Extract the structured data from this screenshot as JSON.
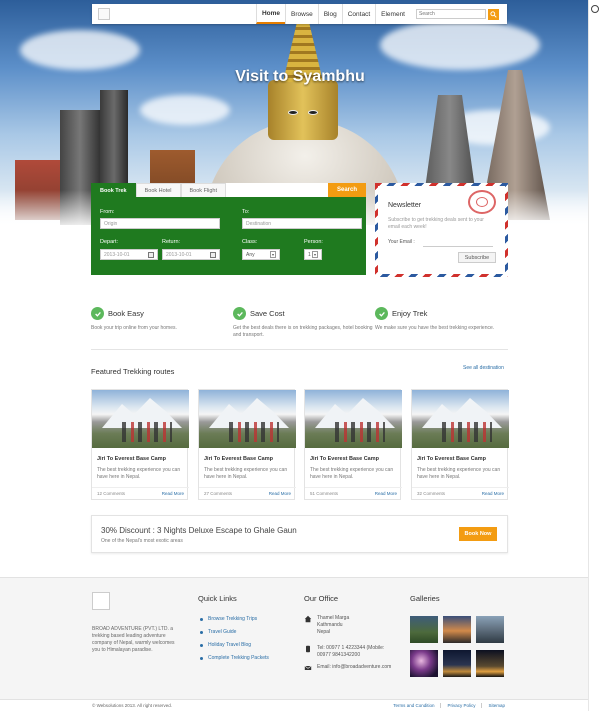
{
  "nav": {
    "items": [
      "Home",
      "Browse",
      "Blog",
      "Contact",
      "Element"
    ],
    "search_placeholder": "Search"
  },
  "hero": {
    "title": "Visit to Syambhu"
  },
  "booking": {
    "tabs": [
      "Book Trek",
      "Book Hotel",
      "Book Flight"
    ],
    "search_label": "Search",
    "from_label": "From:",
    "from_placeholder": "Origin",
    "to_label": "To:",
    "to_placeholder": "Destination",
    "depart_label": "Depart:",
    "depart_value": "2013-10-01",
    "return_label": "Return:",
    "return_value": "2013-10-01",
    "class_label": "Class:",
    "class_value": "Any",
    "person_label": "Person:",
    "person_value": "1"
  },
  "newsletter": {
    "title": "Newsletter",
    "description": "Subscribe to get trekking deals sent to your email each week!",
    "email_label": "Your Email :",
    "button": "Subscribe"
  },
  "features": [
    {
      "title": "Book Easy",
      "desc": "Book your trip online from your homes."
    },
    {
      "title": "Save Cost",
      "desc": "Get the best deals there is on trekking packages, hotel booking and transport."
    },
    {
      "title": "Enjoy Trek",
      "desc": "We make sure you have the best trekking experience."
    }
  ],
  "featured": {
    "title": "Featured Trekking routes",
    "see_all": "See all destination",
    "cards": [
      {
        "title": "Jiri To Everest Base Camp",
        "desc": "The best trekking experience you can have here in Nepal.",
        "comments": "12 Comments",
        "read_more": "Read More"
      },
      {
        "title": "Jiri To Everest Base Camp",
        "desc": "The best trekking experience you can have here in Nepal.",
        "comments": "27 Comments",
        "read_more": "Read More"
      },
      {
        "title": "Jiri To Everest Base Camp",
        "desc": "The best trekking experience you can have here in Nepal.",
        "comments": "51 Comments",
        "read_more": "Read More"
      },
      {
        "title": "Jiri To Everest Base Camp",
        "desc": "The best trekking experience you can have here in Nepal.",
        "comments": "32 Comments",
        "read_more": "Read More"
      }
    ]
  },
  "promo": {
    "title": "30% Discount : 3 Nights Deluxe Escape to Ghale Gaun",
    "subtitle": "One of the Nepal's most exotic areas",
    "button": "Book Now"
  },
  "footer": {
    "about": "BROAD ADVENTURE (PVT.) LTD. a trekking based leading adventure company of Nepal, warmly welcomes you to Himalayan paradise.",
    "quick_links_title": "Quick Links",
    "quick_links": [
      "Browse Trekking Trips",
      "Travel Guide",
      "Holiday Travel Blog",
      "Complete Trekking Packets"
    ],
    "office_title": "Our Office",
    "office_address": "Thamel Marga\nKathmandu\nNepal",
    "office_tel": "Tel: 00977 1 4223344 (Mobile: 00977 9841342200",
    "office_email": "Email: info@broadadventure.com",
    "galleries_title": "Galleries",
    "copyright": "© Websolutions 2013. All right reserved.",
    "bottom_links": [
      "Terms and Condition",
      "Privacy Policy",
      "Sitemap"
    ]
  },
  "colors": {
    "accent": "#f39c12",
    "booking_green": "#1f7a1f",
    "check_green": "#5cb85c",
    "link_blue": "#2a6ea6"
  }
}
